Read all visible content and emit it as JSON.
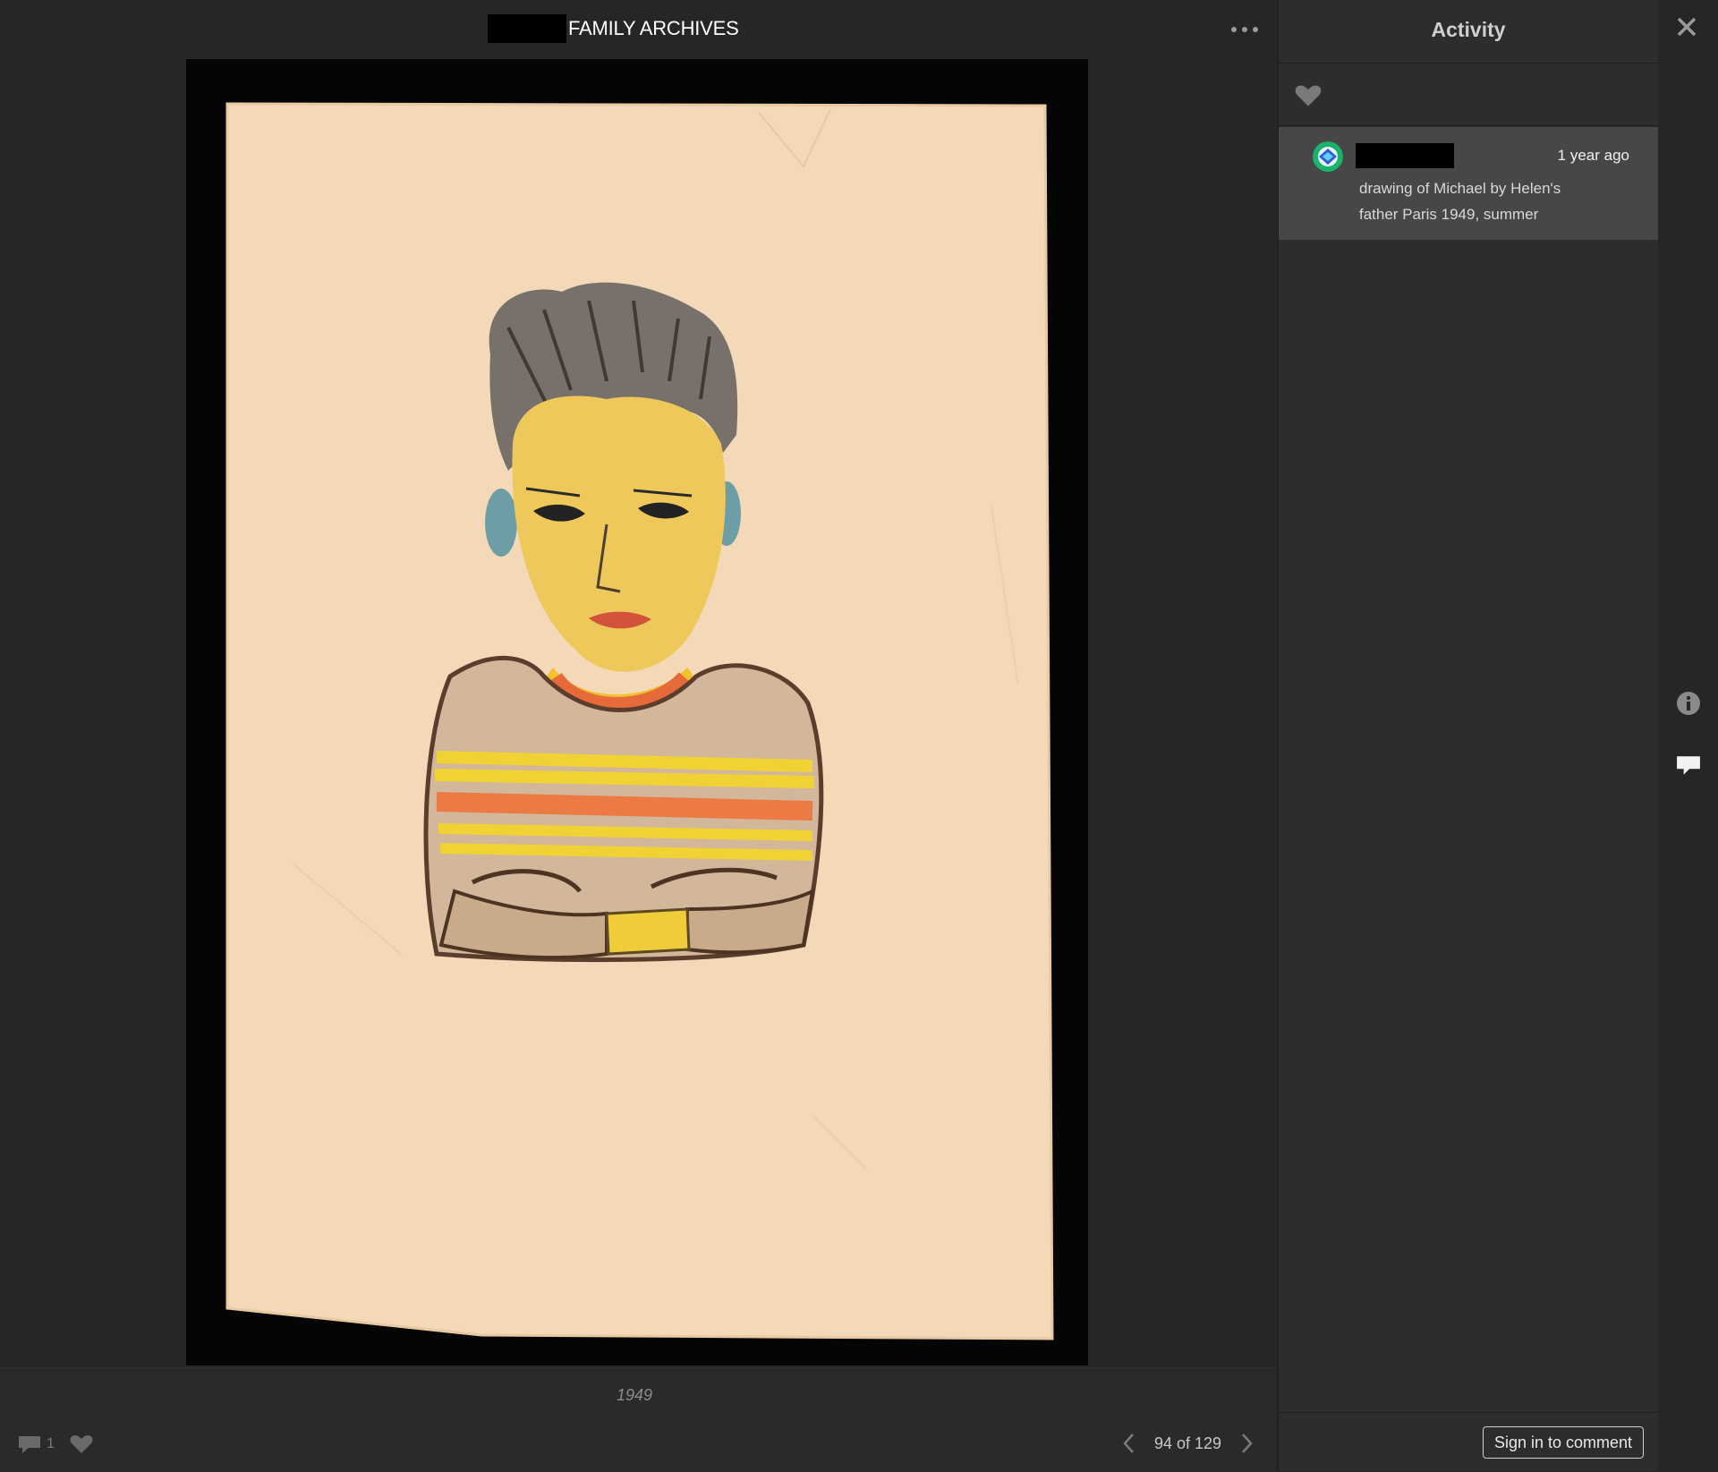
{
  "viewer": {
    "album_title": "FAMILY ARCHIVES",
    "caption": "1949",
    "comment_count": "1",
    "pager_text": "94 of 129"
  },
  "photo": {
    "description_icon": "crayon-portrait-drawing"
  },
  "activity": {
    "title": "Activity",
    "comment": {
      "time": "1 year ago",
      "text": "drawing of Michael by Helen's father Paris 1949, summer"
    },
    "sign_in_label": "Sign in to comment"
  },
  "icons": {
    "more": "more-dots-icon",
    "heart": "heart-icon",
    "speech": "speech-bubble-icon",
    "prev": "chevron-left-icon",
    "next": "chevron-right-icon",
    "close": "close-icon",
    "info": "info-icon"
  },
  "colors": {
    "background": "#262626",
    "panel": "#2d2d2d",
    "comment_card": "#474747",
    "paper": "#f2d7b5"
  }
}
